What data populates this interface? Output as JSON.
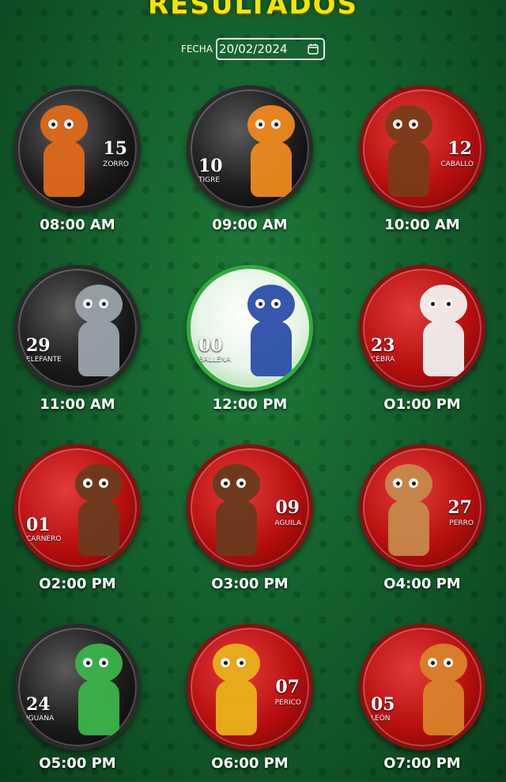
{
  "header": {
    "title": "RESULTADOS"
  },
  "filter": {
    "date_label": "FECHA",
    "date_value": "20/02/2024",
    "calendar_icon": "calendar-icon"
  },
  "results": [
    {
      "time": "08:00 AM",
      "number": "15",
      "animal": "ZORRO",
      "badge": "black",
      "color": "#e06a1b"
    },
    {
      "time": "09:00 AM",
      "number": "10",
      "animal": "TIGRE",
      "badge": "black",
      "color": "#f08a1e"
    },
    {
      "time": "10:00 AM",
      "number": "12",
      "animal": "CABALLO",
      "badge": "red",
      "color": "#7a3b1a"
    },
    {
      "time": "11:00 AM",
      "number": "29",
      "animal": "ELEFANTE",
      "badge": "black",
      "color": "#9aa3ad"
    },
    {
      "time": "12:00 PM",
      "number": "00",
      "animal": "BALLENA",
      "badge": "green",
      "color": "#2b4fa8"
    },
    {
      "time": "O1:00 PM",
      "number": "23",
      "animal": "CEBRA",
      "badge": "red",
      "color": "#f2f2f2"
    },
    {
      "time": "O2:00 PM",
      "number": "01",
      "animal": "CARNERO",
      "badge": "red",
      "color": "#6b3b1f"
    },
    {
      "time": "O3:00 PM",
      "number": "09",
      "animal": "AGUILA",
      "badge": "red",
      "color": "#6a3a1e"
    },
    {
      "time": "O4:00 PM",
      "number": "27",
      "animal": "PERRO",
      "badge": "red",
      "color": "#c7894a"
    },
    {
      "time": "O5:00 PM",
      "number": "24",
      "animal": "IGUANA",
      "badge": "black",
      "color": "#3bb54a"
    },
    {
      "time": "O6:00 PM",
      "number": "07",
      "animal": "PERICO",
      "badge": "red",
      "color": "#e8b21a"
    },
    {
      "time": "O7:00 PM",
      "number": "05",
      "animal": "LEÓN",
      "badge": "red",
      "color": "#d9822b"
    }
  ]
}
